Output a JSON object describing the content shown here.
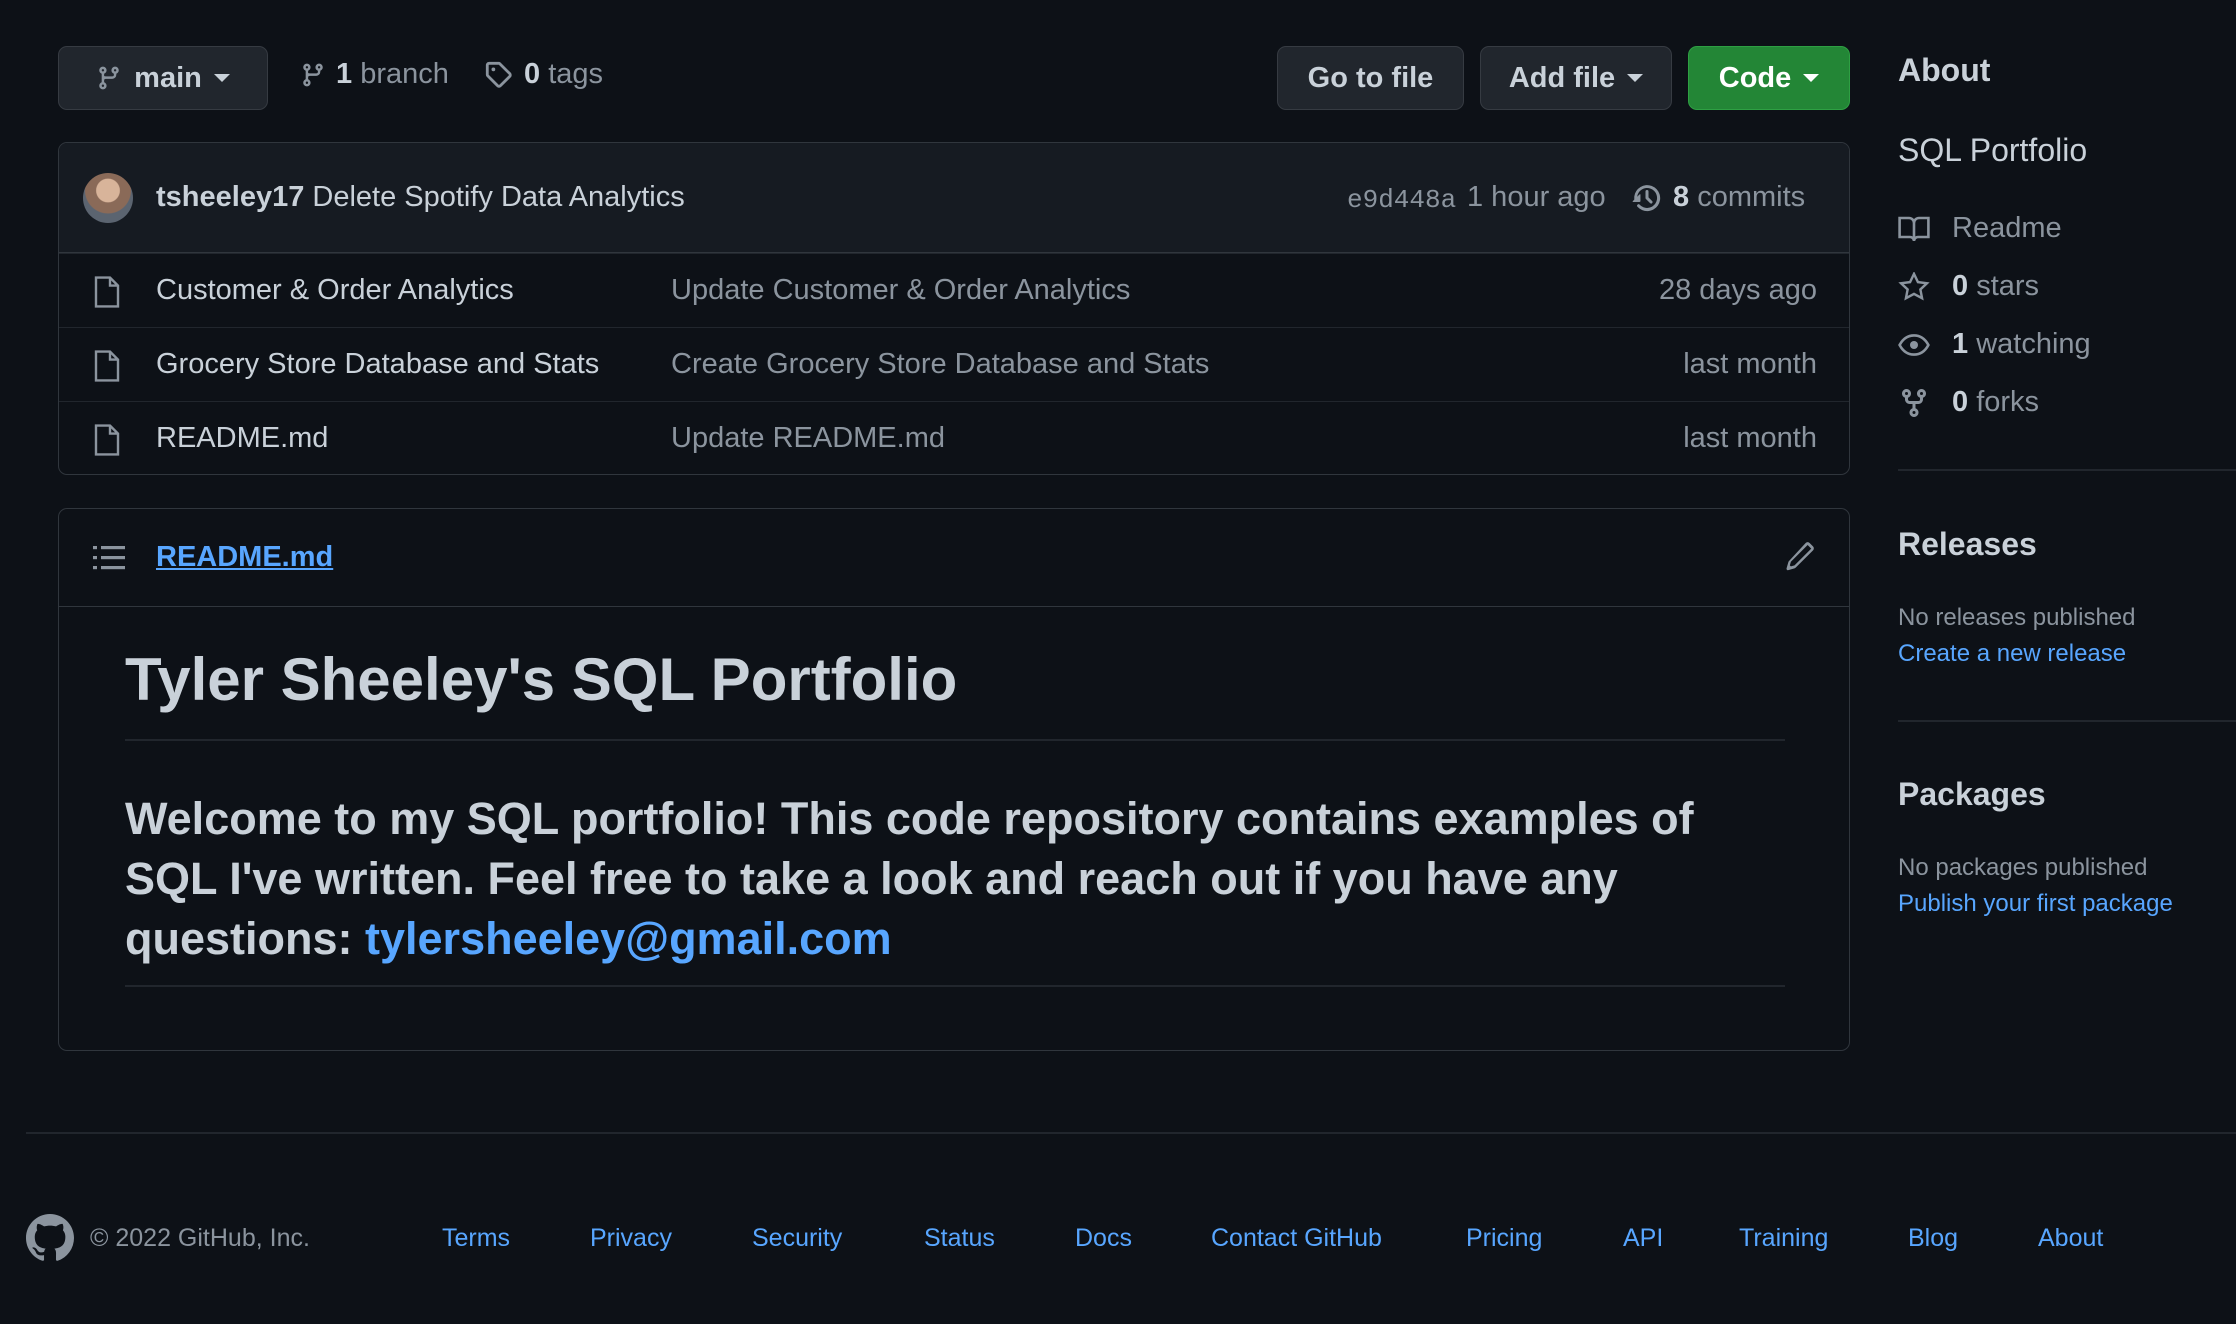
{
  "toolbar": {
    "branch_name": "main",
    "branch_count": "1",
    "branch_label": "branch",
    "tag_count": "0",
    "tag_label": "tags",
    "go_to_file": "Go to file",
    "add_file": "Add file",
    "code": "Code"
  },
  "latest_commit": {
    "author": "tsheeley17",
    "message": "Delete Spotify Data Analytics",
    "hash": "e9d448a",
    "time": "1 hour ago",
    "commit_count": "8",
    "commit_label": "commits"
  },
  "files": [
    {
      "name": "Customer & Order Analytics",
      "message": "Update Customer & Order Analytics",
      "age": "28 days ago"
    },
    {
      "name": "Grocery Store Database and Stats",
      "message": "Create Grocery Store Database and Stats",
      "age": "last month"
    },
    {
      "name": "README.md",
      "message": "Update README.md",
      "age": "last month"
    }
  ],
  "readme": {
    "filename": "README.md",
    "title": "Tyler Sheeley's SQL Portfolio",
    "body": "Welcome to my SQL portfolio! This code repository contains examples of SQL I've written. Feel free to take a look and reach out if you have any questions: ",
    "email": "tylersheeley@gmail.com"
  },
  "sidebar": {
    "about_heading": "About",
    "description": "SQL Portfolio",
    "readme": "Readme",
    "stars_count": "0",
    "stars_label": "stars",
    "watching_count": "1",
    "watching_label": "watching",
    "forks_count": "0",
    "forks_label": "forks",
    "releases_heading": "Releases",
    "releases_note": "No releases published",
    "releases_link": "Create a new release",
    "packages_heading": "Packages",
    "packages_note": "No packages published",
    "packages_link": "Publish your first package"
  },
  "footer": {
    "copyright": "© 2022 GitHub, Inc.",
    "links": [
      "Terms",
      "Privacy",
      "Security",
      "Status",
      "Docs",
      "Contact GitHub",
      "Pricing",
      "API",
      "Training",
      "Blog",
      "About"
    ]
  },
  "colors": {
    "background": "#0d1117",
    "accent_link": "#58a6ff",
    "code_button": "#238636"
  }
}
